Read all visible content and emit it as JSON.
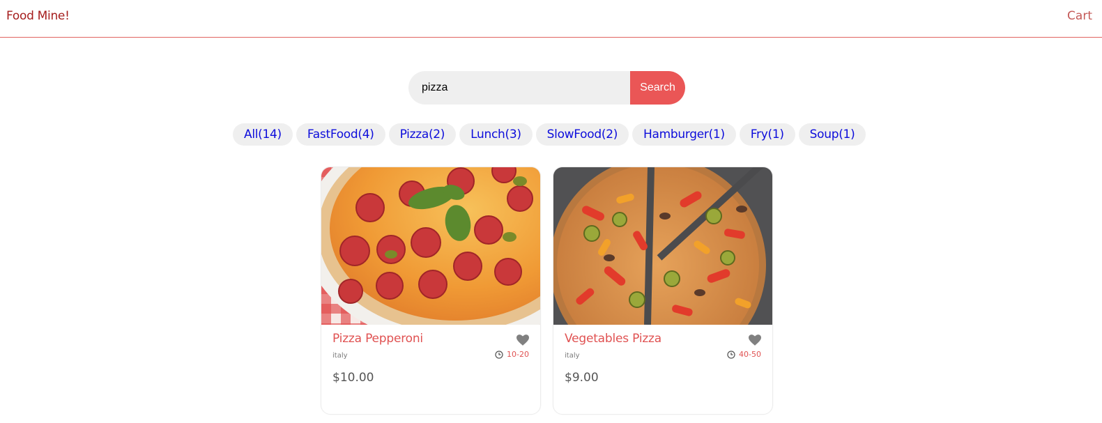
{
  "header": {
    "logo": "Food Mine!",
    "cart_label": "Cart"
  },
  "search": {
    "value": "pizza",
    "placeholder": "Search Food Mine!",
    "button_label": "Search"
  },
  "tags": [
    {
      "label": "All(14)"
    },
    {
      "label": "FastFood(4)"
    },
    {
      "label": "Pizza(2)"
    },
    {
      "label": "Lunch(3)"
    },
    {
      "label": "SlowFood(2)"
    },
    {
      "label": "Hamburger(1)"
    },
    {
      "label": "Fry(1)"
    },
    {
      "label": "Soup(1)"
    }
  ],
  "foods": [
    {
      "name": "Pizza Pepperoni",
      "origin": "italy",
      "cook_time": "10-20",
      "price": "$10.00",
      "favorite": true,
      "image_icon": "pizza-pepperoni-photo"
    },
    {
      "name": "Vegetables Pizza",
      "origin": "italy",
      "cook_time": "40-50",
      "price": "$9.00",
      "favorite": true,
      "image_icon": "vegetables-pizza-photo"
    }
  ],
  "colors": {
    "brand": "#a51d1d",
    "accent": "#ea5656",
    "tag_text": "#0d0ddb",
    "tag_bg": "#efefef",
    "heart": "#808080"
  }
}
